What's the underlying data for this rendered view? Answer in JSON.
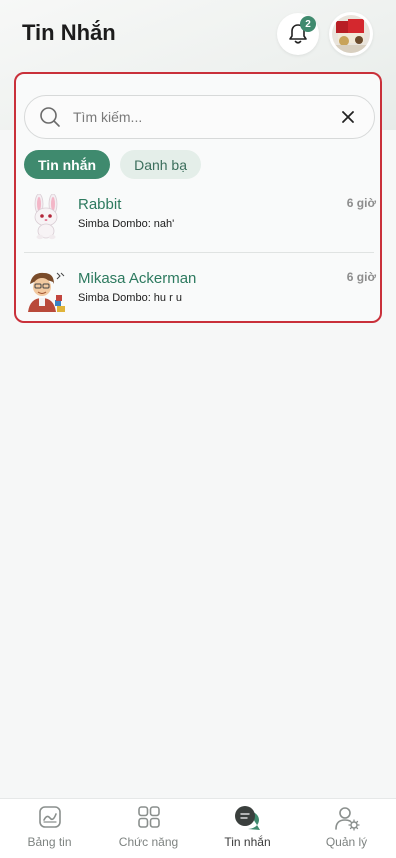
{
  "header": {
    "title": "Tin Nhắn",
    "notification_count": "2"
  },
  "search": {
    "placeholder": "Tìm kiếm..."
  },
  "tabs": [
    {
      "label": "Tin nhắn",
      "active": true
    },
    {
      "label": "Danh bạ",
      "active": false
    }
  ],
  "conversations": [
    {
      "name": "Rabbit",
      "time": "6 giờ",
      "preview": "Simba Dombo: nah'"
    },
    {
      "name": "Mikasa Ackerman",
      "time": "6 giờ",
      "preview": "Simba Dombo: hu r u"
    }
  ],
  "bottom_nav": [
    {
      "label": "Bảng tin",
      "icon": "newsfeed-icon"
    },
    {
      "label": "Chức năng",
      "icon": "grid-icon"
    },
    {
      "label": "Tin nhắn",
      "icon": "chat-icon",
      "active": true
    },
    {
      "label": "Quản lý",
      "icon": "user-settings-icon"
    }
  ],
  "colors": {
    "accent": "#3f8a6e",
    "highlight_border": "#c9303a"
  }
}
